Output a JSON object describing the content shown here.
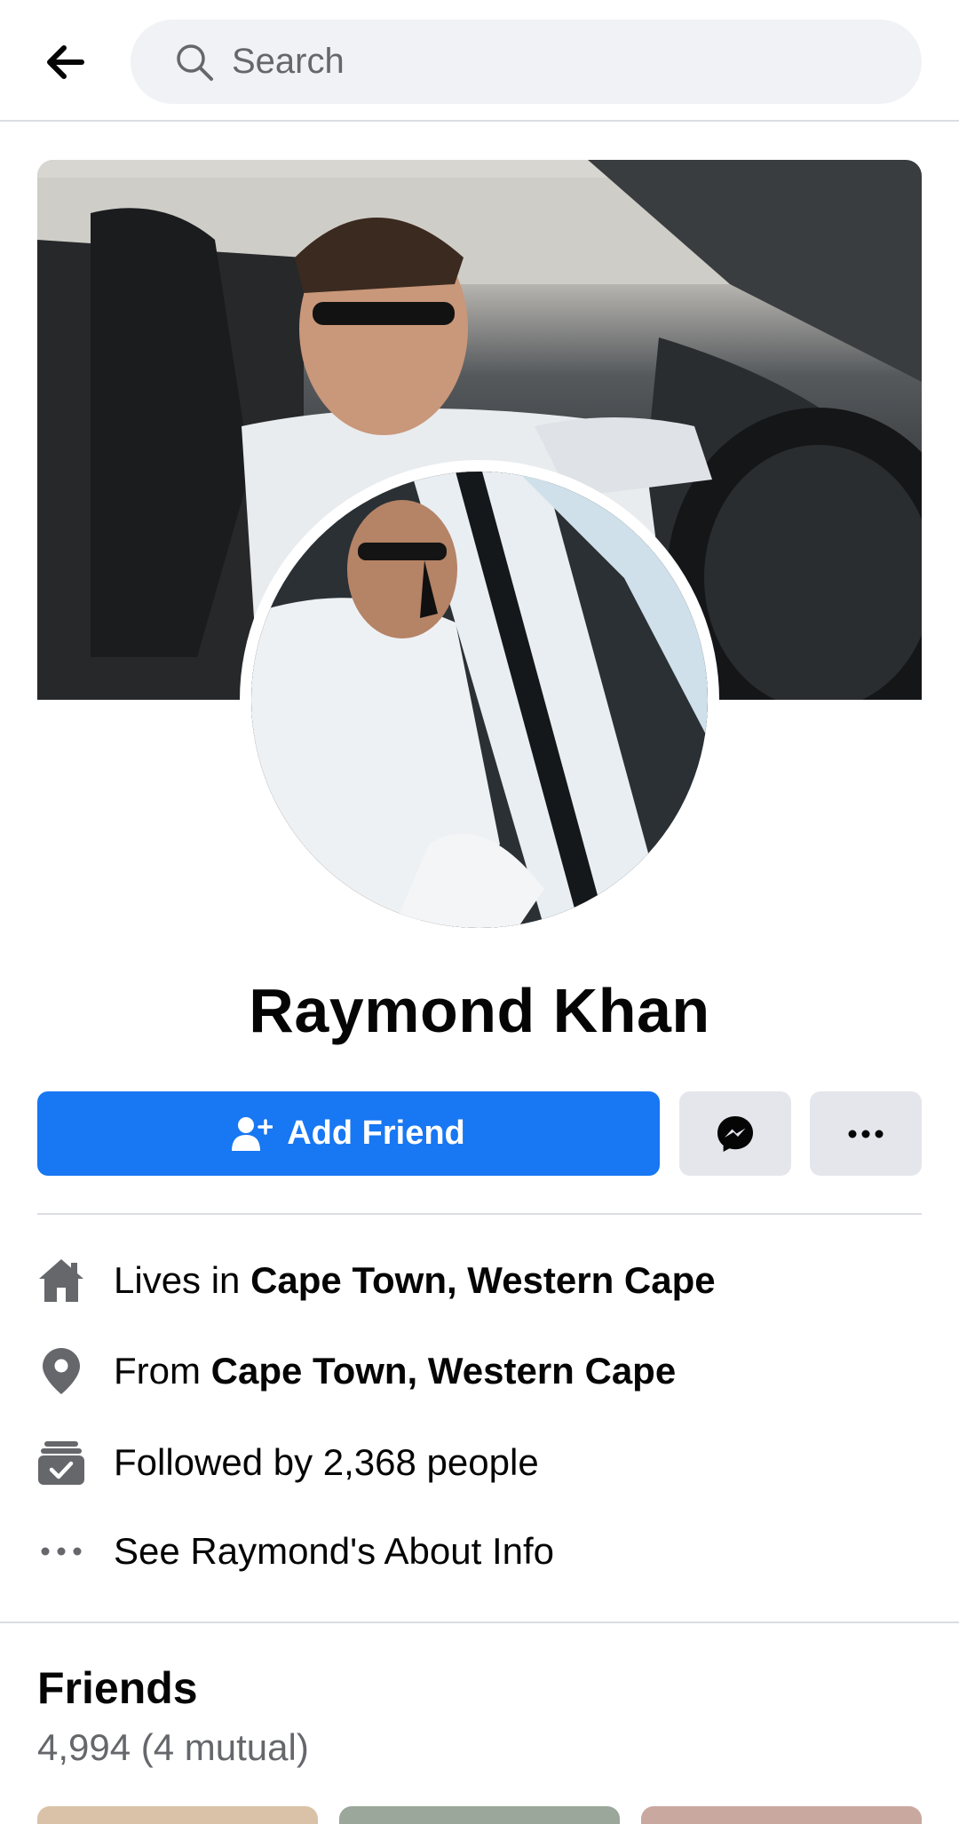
{
  "header": {
    "search_placeholder": "Search"
  },
  "profile": {
    "name": "Raymond Khan"
  },
  "actions": {
    "add_friend_label": "Add Friend"
  },
  "intro": {
    "lives_in_prefix": "Lives in ",
    "lives_in_place": "Cape Town, Western Cape",
    "from_prefix": "From ",
    "from_place": "Cape Town, Western Cape",
    "followed_by": "Followed by 2,368 people",
    "about_link": "See Raymond's About Info"
  },
  "friends": {
    "title": "Friends",
    "count": "4,994 (4 mutual)"
  },
  "colors": {
    "primary": "#1877f2",
    "secondary_bg": "#e4e6eb",
    "muted_text": "#65676b",
    "icon_gray": "#65676b"
  }
}
